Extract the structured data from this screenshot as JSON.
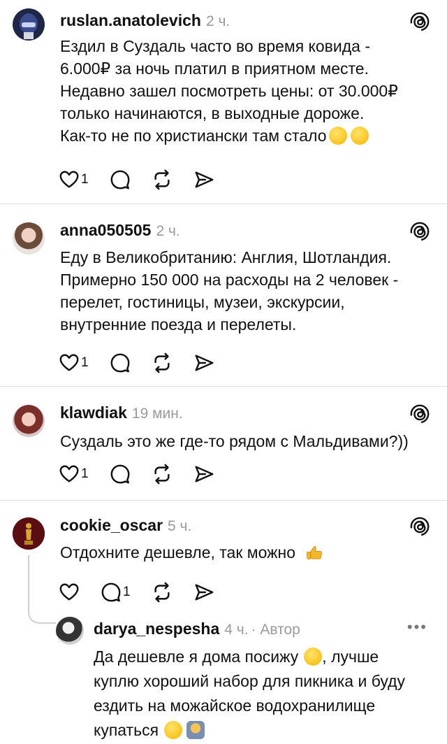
{
  "icons": {
    "like": "heart-icon",
    "comment": "comment-icon",
    "repost": "repost-icon",
    "share": "share-icon",
    "threads": "threads-logo-icon"
  },
  "colors": {
    "text": "#111111",
    "muted": "#9a9a9a",
    "divider": "#dcdcdc"
  },
  "comments": [
    {
      "username": "ruslan.anatolevich",
      "time": "2 ч.",
      "lines": [
        "Ездил в Суздаль часто во время ковида -",
        "6.000₽ за ночь платил в приятном месте.",
        "Недавно зашел посмотреть цены: от 30.000₽",
        "только начинаются, в выходные дороже.",
        "Как-то не по христиански там стало"
      ],
      "likes": "1"
    },
    {
      "username": "anna050505",
      "time": "2 ч.",
      "lines": [
        "Еду в Великобританию: Англия, Шотландия.",
        "Примерно 150 000 на расходы на 2 человек -",
        "перелет, гостиницы, музеи, экскурсии,",
        "внутренние поезда и перелеты."
      ],
      "likes": "1"
    },
    {
      "username": "klawdiak",
      "time": "19 мин.",
      "lines": [
        "Суздаль это же где-то рядом с Мальдивами?))"
      ],
      "likes": "1"
    },
    {
      "username": "cookie_oscar",
      "time": "5 ч.",
      "lines": [
        "Отдохните дешевле, так можно"
      ],
      "replies": "1"
    }
  ],
  "reply": {
    "username": "darya_nespesha",
    "time": "4 ч.",
    "author_label": "· Автор",
    "more": "•••",
    "lines": [
      "Да дешевле я дома посижу",
      ", лучше",
      "куплю хороший набор для пикника и буду",
      "ездить на можайское водохранилище",
      "купаться"
    ]
  }
}
